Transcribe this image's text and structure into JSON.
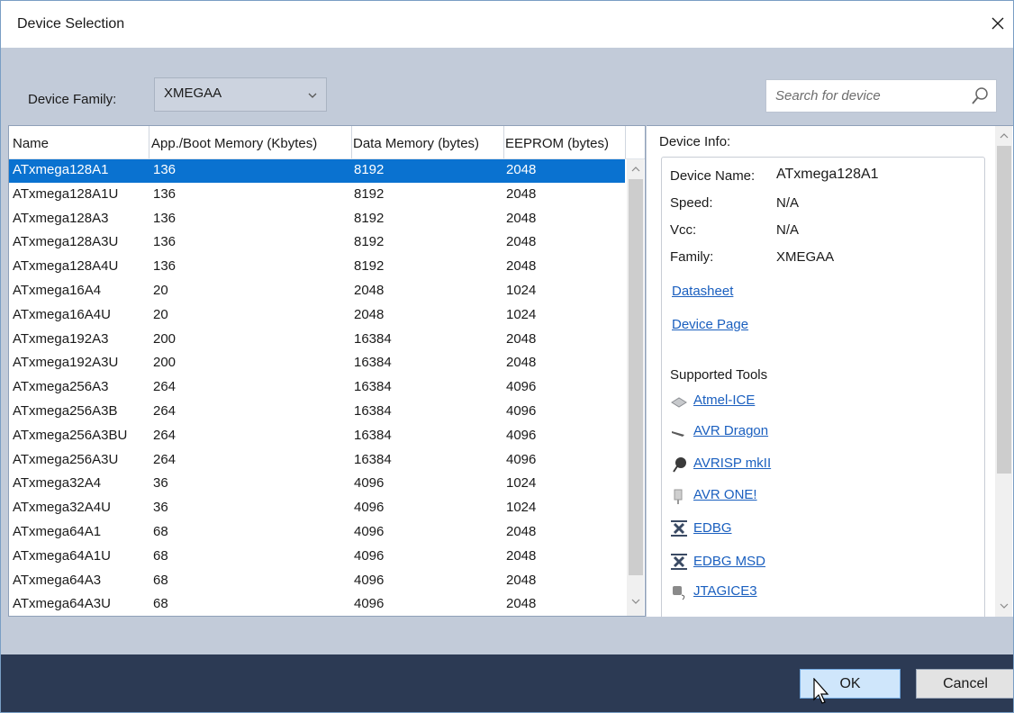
{
  "window": {
    "title": "Device Selection"
  },
  "filter": {
    "family_label": "Device Family:",
    "family_value": "XMEGAA",
    "search_placeholder": "Search for device"
  },
  "table": {
    "headers": [
      "Name",
      "App./Boot Memory (Kbytes)",
      "Data Memory (bytes)",
      "EEPROM (bytes)"
    ],
    "selected_index": 0,
    "rows": [
      {
        "name": "ATxmega128A1",
        "app": "136",
        "data": "8192",
        "eeprom": "2048"
      },
      {
        "name": "ATxmega128A1U",
        "app": "136",
        "data": "8192",
        "eeprom": "2048"
      },
      {
        "name": "ATxmega128A3",
        "app": "136",
        "data": "8192",
        "eeprom": "2048"
      },
      {
        "name": "ATxmega128A3U",
        "app": "136",
        "data": "8192",
        "eeprom": "2048"
      },
      {
        "name": "ATxmega128A4U",
        "app": "136",
        "data": "8192",
        "eeprom": "2048"
      },
      {
        "name": "ATxmega16A4",
        "app": "20",
        "data": "2048",
        "eeprom": "1024"
      },
      {
        "name": "ATxmega16A4U",
        "app": "20",
        "data": "2048",
        "eeprom": "1024"
      },
      {
        "name": "ATxmega192A3",
        "app": "200",
        "data": "16384",
        "eeprom": "2048"
      },
      {
        "name": "ATxmega192A3U",
        "app": "200",
        "data": "16384",
        "eeprom": "2048"
      },
      {
        "name": "ATxmega256A3",
        "app": "264",
        "data": "16384",
        "eeprom": "4096"
      },
      {
        "name": "ATxmega256A3B",
        "app": "264",
        "data": "16384",
        "eeprom": "4096"
      },
      {
        "name": "ATxmega256A3BU",
        "app": "264",
        "data": "16384",
        "eeprom": "4096"
      },
      {
        "name": "ATxmega256A3U",
        "app": "264",
        "data": "16384",
        "eeprom": "4096"
      },
      {
        "name": "ATxmega32A4",
        "app": "36",
        "data": "4096",
        "eeprom": "1024"
      },
      {
        "name": "ATxmega32A4U",
        "app": "36",
        "data": "4096",
        "eeprom": "1024"
      },
      {
        "name": "ATxmega64A1",
        "app": "68",
        "data": "4096",
        "eeprom": "2048"
      },
      {
        "name": "ATxmega64A1U",
        "app": "68",
        "data": "4096",
        "eeprom": "2048"
      },
      {
        "name": "ATxmega64A3",
        "app": "68",
        "data": "4096",
        "eeprom": "2048"
      },
      {
        "name": "ATxmega64A3U",
        "app": "68",
        "data": "4096",
        "eeprom": "2048"
      }
    ]
  },
  "device_info": {
    "title": "Device Info:",
    "name_label": "Device Name:",
    "name_value": "ATxmega128A1",
    "speed_label": "Speed:",
    "speed_value": "N/A",
    "vcc_label": "Vcc:",
    "vcc_value": "N/A",
    "family_label": "Family:",
    "family_value": "XMEGAA",
    "datasheet_link": "Datasheet",
    "device_page_link": "Device Page",
    "tools_title": "Supported Tools",
    "tools": [
      {
        "label": "Atmel-ICE",
        "icon": "atmel-ice-icon"
      },
      {
        "label": "AVR Dragon",
        "icon": "avr-dragon-icon"
      },
      {
        "label": "AVRISP mkII",
        "icon": "avrisp-icon"
      },
      {
        "label": "AVR ONE!",
        "icon": "avr-one-icon"
      },
      {
        "label": "EDBG",
        "icon": "edbg-icon"
      },
      {
        "label": "EDBG MSD",
        "icon": "edbg-icon"
      },
      {
        "label": "JTAGICE3",
        "icon": "jtagice3-icon"
      }
    ]
  },
  "buttons": {
    "ok": "OK",
    "cancel": "Cancel"
  },
  "colors": {
    "accent": "#0a72d0",
    "link": "#1a5fbf",
    "footer": "#2c3a54",
    "panel": "#c2cbd9"
  }
}
